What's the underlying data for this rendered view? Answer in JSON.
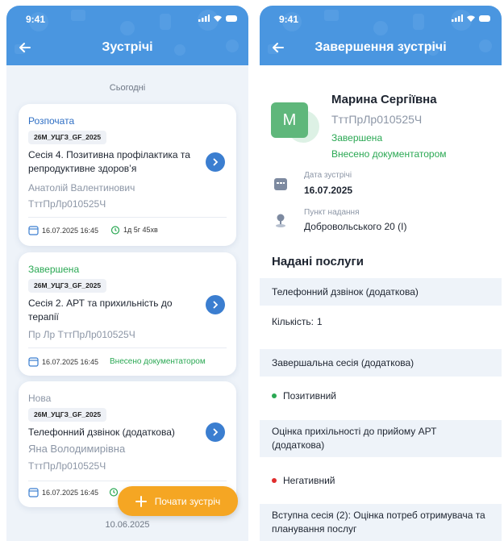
{
  "status_time": "9:41",
  "left": {
    "title": "Зустрічі",
    "date_today": "Сьогодні",
    "date_bottom": "10.06.2025",
    "cards": [
      {
        "status": "Розпочата",
        "status_color": "#2f6fc4",
        "code": "26M_УЦГЗ_GF_2025",
        "session": "Сесія 4. Позитивна профілактика та репродуктивне здоров’я",
        "person_name": "Анатолій Валентинович",
        "person_code": "ТттПрЛр010525Ч",
        "date": "16.07.2025 16:45",
        "duration": "1д 5г 45хв"
      },
      {
        "status": "Завершена",
        "status_color": "#2aa853",
        "code": "26M_УЦГЗ_GF_2025",
        "session": "Сесія 2. АРТ та прихильність до терапії",
        "person_name": "Пр Лр ТттПрЛр010525Ч",
        "date": "16.07.2025 16:45",
        "note": "Внесено документатором"
      },
      {
        "status": "Нова",
        "status_color": "#8c96a6",
        "code": "26M_УЦГЗ_GF_2025",
        "session": "Телефонний дзвінок (додаткова)",
        "person_name": "Яна Володимирівна",
        "person_code": "ТттПрЛр010525Ч",
        "date": "16.07.2025 16:45"
      }
    ],
    "fab_label": "Почати зустріч"
  },
  "right": {
    "title": "Завершення зустрічі",
    "avatar_letter": "M",
    "name": "Марина Сергіївна",
    "code": "ТттПрЛр010525Ч",
    "status": "Завершена",
    "status2": "Внесено документатором",
    "date_label": "Дата зустрічі",
    "date_value": "16.07.2025",
    "place_label": "Пункт надання",
    "place_value": "Добровольського 20 (I)",
    "section_title": "Надані послуги",
    "services": {
      "s1_title": "Телефонний дзвінок (додаткова)",
      "s1_qty_label": "Кількість:",
      "s1_qty_value": "1",
      "s2_title": "Завершальна сесія (додаткова)",
      "s2_result": "Позитивний",
      "s3_title": "Оцінка прихільності до прийому АРТ (додаткова)",
      "s3_result": "Негативний",
      "s4_title": "Вступна сесія (2): Оцінка потреб отримувача та планування послуг"
    }
  },
  "colors": {
    "header": "#4a96e0",
    "accent": "#3b7ed0",
    "positive": "#2aa853",
    "negative": "#e02d2d",
    "fab": "#f5a623"
  },
  "icons": [
    "back-arrow-icon",
    "signal-icon",
    "wifi-icon",
    "battery-icon",
    "chevron-right-icon",
    "calendar-icon",
    "timer-icon",
    "plus-icon",
    "map-pin-icon"
  ]
}
